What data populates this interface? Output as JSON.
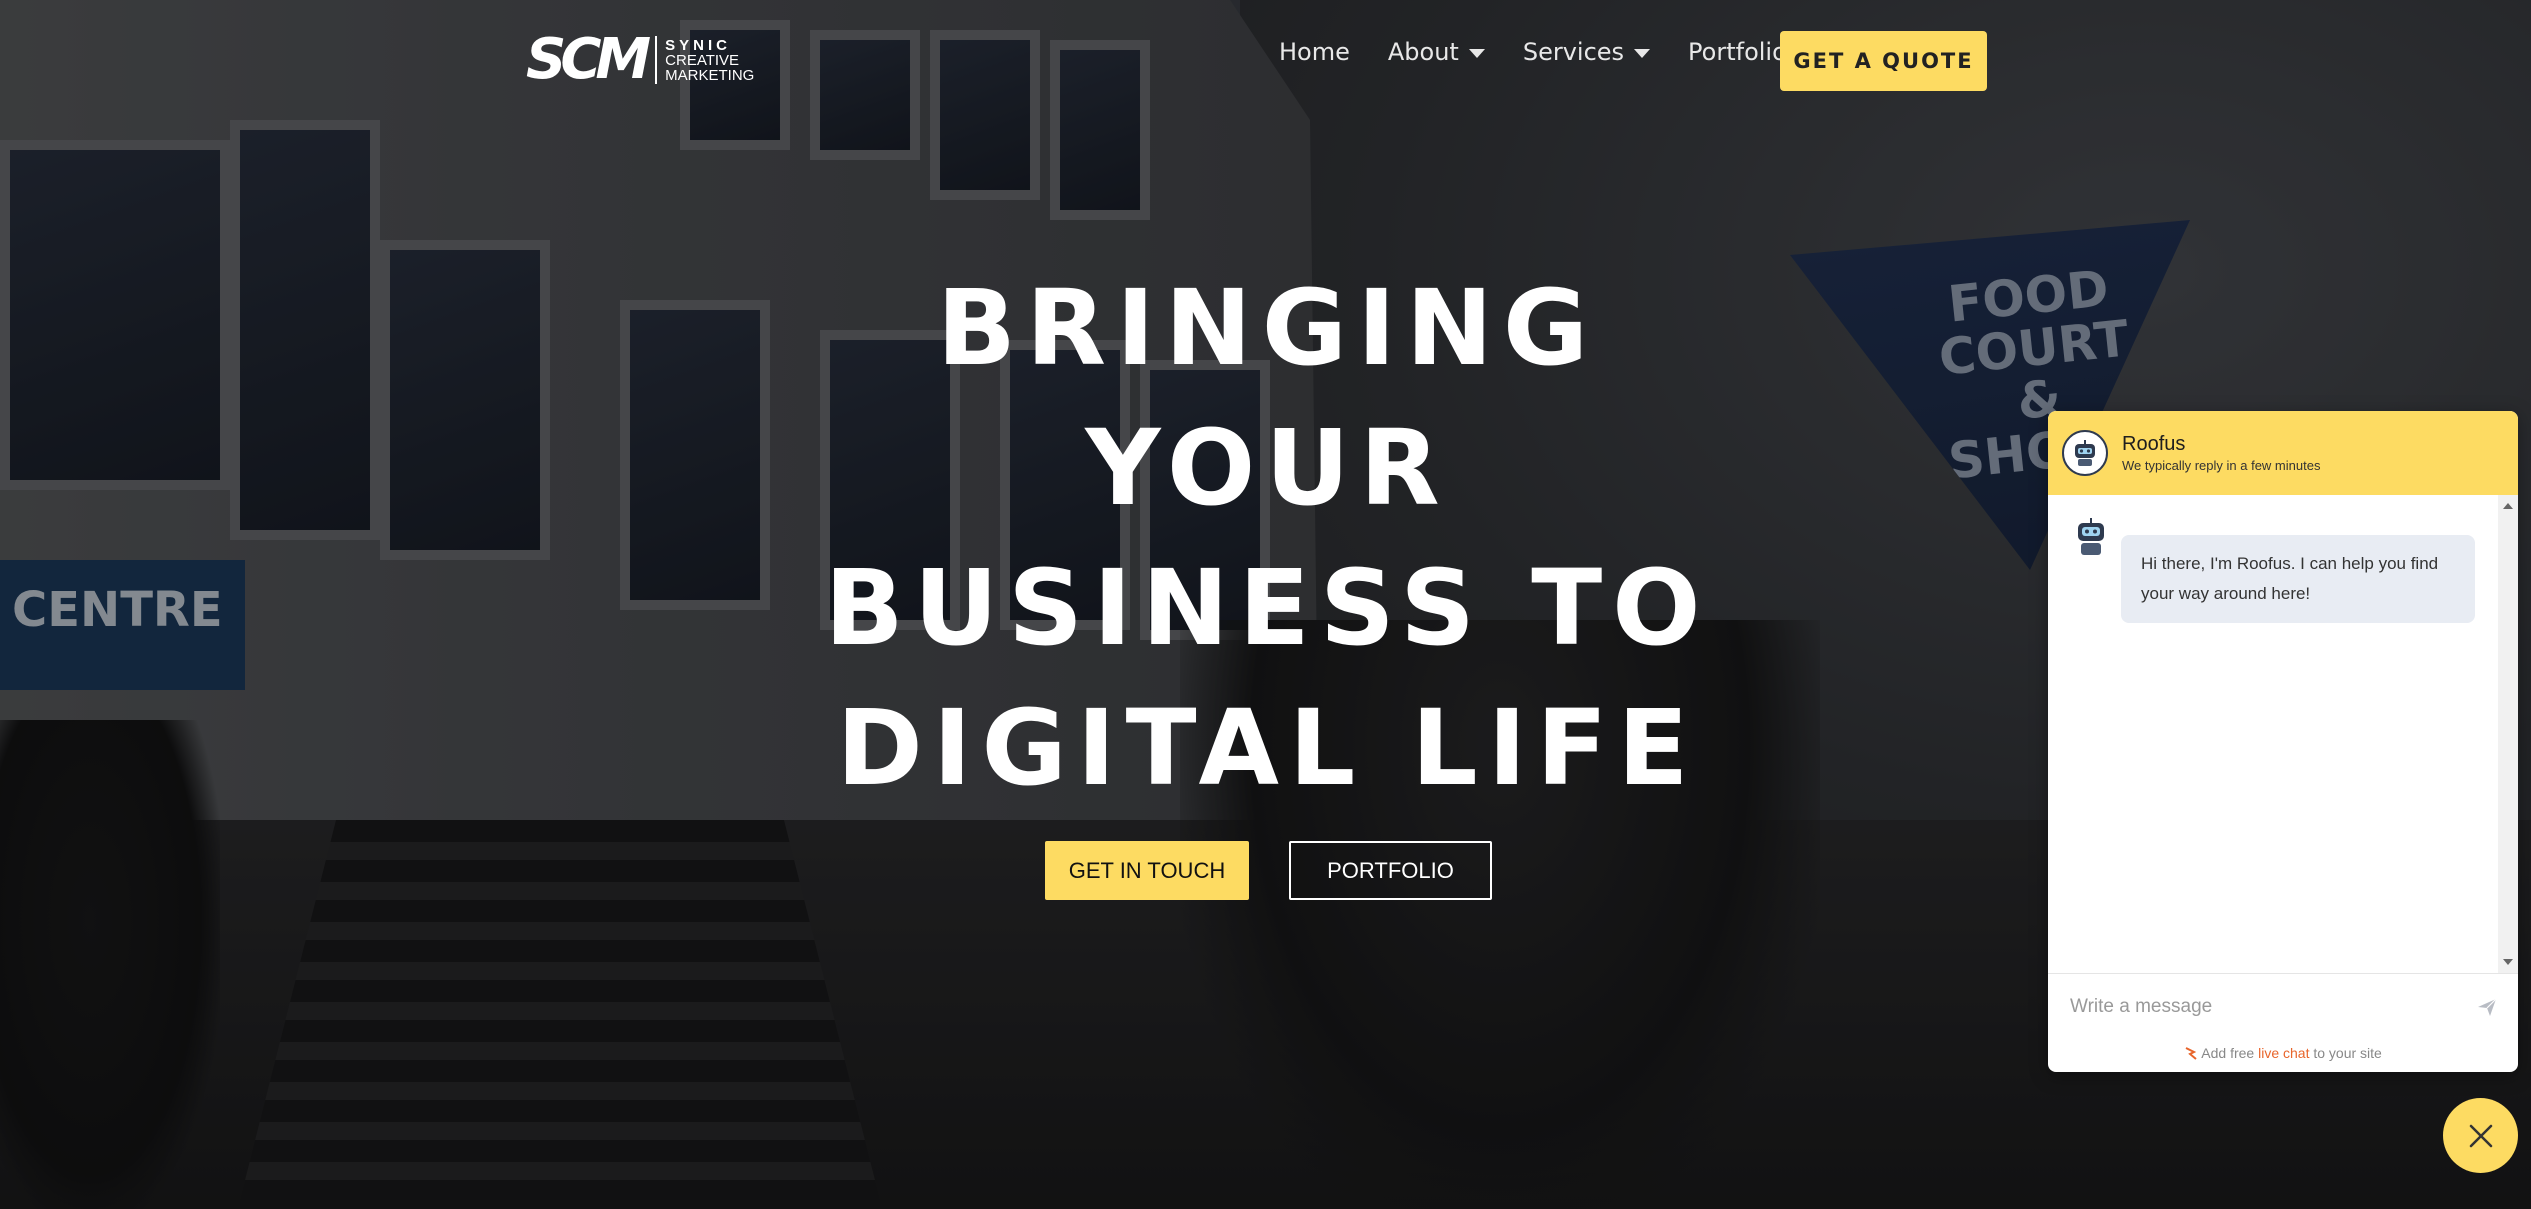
{
  "brand": {
    "logo_mark": "SCM",
    "logo_line1": "SYNIC",
    "logo_line2": "CREATIVE",
    "logo_line3": "MARKETING"
  },
  "nav": {
    "items": [
      {
        "label": "Home",
        "dropdown": false
      },
      {
        "label": "About",
        "dropdown": true
      },
      {
        "label": "Services",
        "dropdown": true
      },
      {
        "label": "Portfolio",
        "dropdown": false
      }
    ],
    "cta": "GET A QUOTE"
  },
  "hero": {
    "title_lines": [
      "BRINGING",
      "YOUR",
      "BUSINESS TO",
      "DIGITAL LIFE"
    ],
    "primary_button": "GET IN TOUCH",
    "secondary_button": "PORTFOLIO"
  },
  "background_signs": {
    "centre": "CENTRE",
    "food_court_line1": "FOOD",
    "food_court_line2": "COURT",
    "food_court_line3": "&",
    "food_court_line4": "SHOPS"
  },
  "chat": {
    "agent_name": "Roofus",
    "agent_status": "We typically reply in a few minutes",
    "message": "Hi there, I'm Roofus. I can help you find your way around here!",
    "input_placeholder": "Write a message",
    "footer_prefix": "Add free ",
    "footer_link": "live chat",
    "footer_suffix": " to your site"
  },
  "colors": {
    "accent": "#fddb62",
    "chat_bubble": "#e8ecf3",
    "footer_link": "#e8652b"
  },
  "icons": [
    "robot-avatar-icon",
    "send-icon",
    "close-icon",
    "chevron-down-icon",
    "chat-logo-icon"
  ]
}
